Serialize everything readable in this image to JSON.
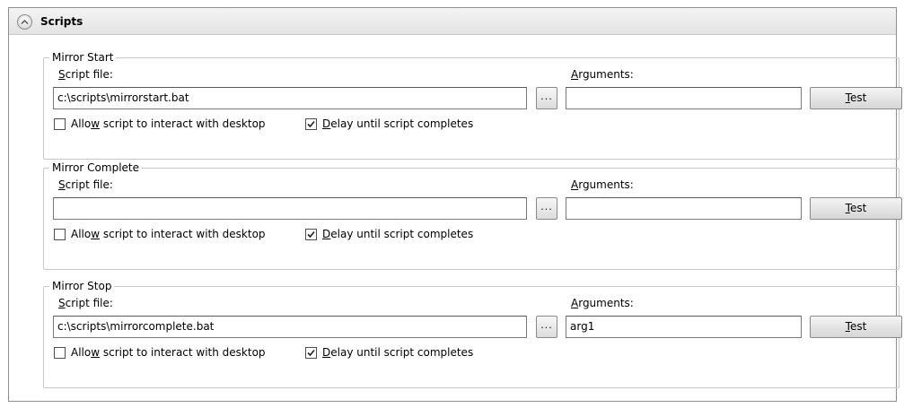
{
  "section": {
    "title": "Scripts"
  },
  "groups": [
    {
      "title": "Mirror Start",
      "script_label_ak": "S",
      "script_label_rest": "cript file:",
      "script_value": "c:\\scripts\\mirrorstart.bat",
      "args_label_ak": "A",
      "args_label_rest": "rguments:",
      "args_value": "",
      "browse_label": "...",
      "test_ak": "T",
      "test_rest": "est",
      "allow_pre": "Allo",
      "allow_ak": "w",
      "allow_post": " script to interact with desktop",
      "allow_checked": false,
      "delay_ak": "D",
      "delay_rest": "elay until script completes",
      "delay_checked": true
    },
    {
      "title": "Mirror Complete",
      "script_label_ak": "S",
      "script_label_rest": "cript file:",
      "script_value": "",
      "args_label_ak": "A",
      "args_label_rest": "rguments:",
      "args_value": "",
      "browse_label": "...",
      "test_ak": "T",
      "test_rest": "est",
      "allow_pre": "Allo",
      "allow_ak": "w",
      "allow_post": " script to interact with desktop",
      "allow_checked": false,
      "delay_ak": "D",
      "delay_rest": "elay until script completes",
      "delay_checked": true
    },
    {
      "title": "Mirror Stop",
      "script_label_ak": "S",
      "script_label_rest": "cript file:",
      "script_value": "c:\\scripts\\mirrorcomplete.bat",
      "args_label_ak": "A",
      "args_label_rest": "rguments:",
      "args_value": "arg1",
      "browse_label": "...",
      "test_ak": "T",
      "test_rest": "est",
      "allow_pre": "Allo",
      "allow_ak": "w",
      "allow_post": " script to interact with desktop",
      "allow_checked": false,
      "delay_ak": "D",
      "delay_rest": "elay until script completes",
      "delay_checked": true
    }
  ]
}
